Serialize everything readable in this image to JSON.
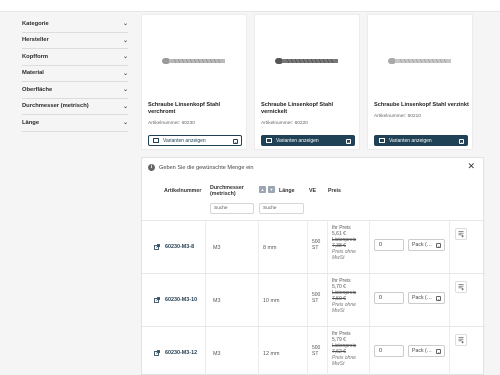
{
  "sidebar": {
    "filters": [
      {
        "label": "Kategorie"
      },
      {
        "label": "Hersteller"
      },
      {
        "label": "Kopfform"
      },
      {
        "label": "Material"
      },
      {
        "label": "Oberfläche"
      },
      {
        "label": "Durchmesser (metrisch)"
      },
      {
        "label": "Länge"
      }
    ],
    "chevron_icon": "chevron-down-icon"
  },
  "products": [
    {
      "title": "Schraube Linsenkopf Stahl verchromt",
      "artnr": "Artikelnummer: 60230",
      "button": "Varianten anzeigen"
    },
    {
      "title": "Schraube Linsenkopf Stahl vernickelt",
      "artnr": "Artikelnummer: 60220",
      "button": "Varianten anzeigen"
    },
    {
      "title": "Schraube Linsenkopf Stahl verzinkt",
      "artnr": "Artikelnummer: 60210",
      "button": "Varianten anzeigen"
    }
  ],
  "variants": {
    "info": "Geben Sie die gewünschte Menge ein",
    "close_icon": "close-icon",
    "headers": {
      "artikelnummer": "Artikelnummer",
      "durchmesser": "Durchmesser (metrisch)",
      "laenge": "Länge",
      "ve": "VE",
      "preis": "Preis"
    },
    "filter_placeholder_durchmesser": "Suche",
    "filter_placeholder_laenge": "Suche",
    "rows": [
      {
        "artnr": "60230-M3-8",
        "durchmesser": "M3",
        "laenge": "8 mm",
        "ve1": "500",
        "ve2": "ST",
        "price_label": "Ihr Preis",
        "price": "5,61 €",
        "list_label": "Listenpreis",
        "list_price": "7,38 €",
        "net1": "Preis ohne",
        "net2": "MwSt",
        "qty": "0",
        "unit": "Pack (…"
      },
      {
        "artnr": "60230-M3-10",
        "durchmesser": "M3",
        "laenge": "10 mm",
        "ve1": "500",
        "ve2": "ST",
        "price_label": "Ihr Preis",
        "price": "5,70 €",
        "list_label": "Listenpreis",
        "list_price": "7,50 €",
        "net1": "Preis ohne",
        "net2": "MwSt",
        "qty": "0",
        "unit": "Pack (…"
      },
      {
        "artnr": "60230-M3-12",
        "durchmesser": "M3",
        "laenge": "12 mm",
        "ve1": "500",
        "ve2": "ST",
        "price_label": "Ihr Preis",
        "price": "5,79 €",
        "list_label": "Listenpreis",
        "list_price": "7,62 €",
        "net1": "Preis ohne",
        "net2": "MwSt",
        "qty": "0",
        "unit": "Pack (…"
      }
    ]
  },
  "colors": {
    "accent": "#1f4257",
    "background": "#f5f5f5"
  }
}
